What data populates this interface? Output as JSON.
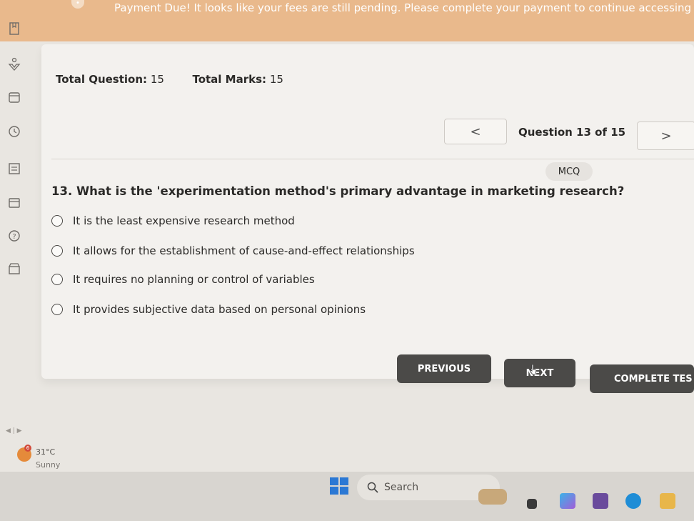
{
  "banner": {
    "message": "Payment Due! It looks like your fees are still pending. Please complete your payment to continue accessing you"
  },
  "sidebar": {
    "icons": [
      "bookmark-icon",
      "award-icon",
      "calendar-icon",
      "clock-icon",
      "report-icon",
      "card-icon",
      "help-icon",
      "store-icon"
    ]
  },
  "stats": {
    "total_question_label": "Total Question:",
    "total_question_value": "15",
    "total_marks_label": "Total Marks:",
    "total_marks_value": "15"
  },
  "navigation": {
    "prev_symbol": "<",
    "next_symbol": ">",
    "counter": "Question 13 of 15"
  },
  "question": {
    "type": "MCQ",
    "text": "13. What is the 'experimentation method's primary advantage in marketing research?",
    "options": [
      "It is the least expensive research method",
      "It allows for the establishment of cause-and-effect relationships",
      "It requires no planning or control of variables",
      "It provides subjective data based on personal opinions"
    ]
  },
  "buttons": {
    "previous": "PREVIOUS",
    "next": "NEXT",
    "complete": "COMPLETE TES"
  },
  "weather": {
    "badge": "6",
    "temperature": "31°C",
    "condition": "Sunny"
  },
  "taskbar": {
    "search_label": "Search"
  },
  "colors": {
    "banner": "#e9b98c",
    "button": "#4b4a48",
    "panel": "#f3f1ee"
  }
}
